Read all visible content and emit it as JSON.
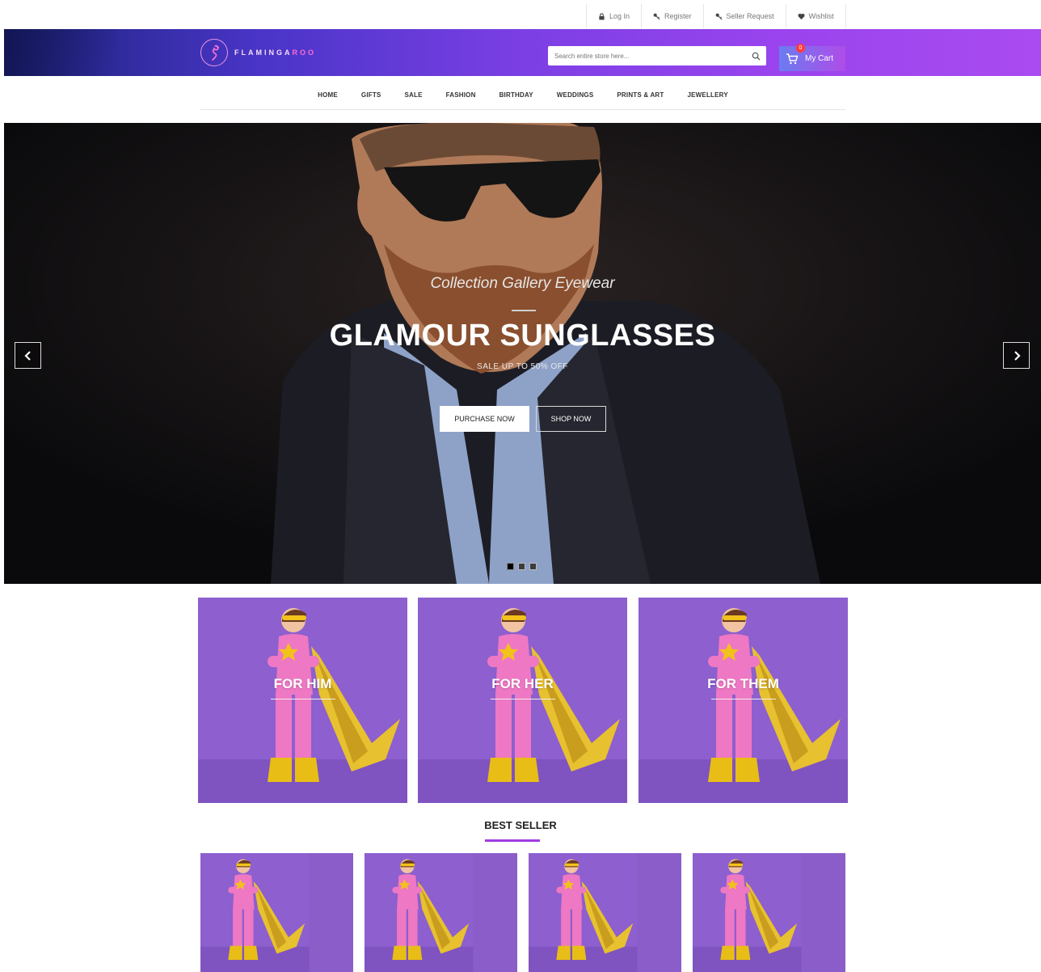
{
  "topbar": {
    "links": [
      {
        "label": "Log In",
        "icon": "lock-icon"
      },
      {
        "label": "Register",
        "icon": "key-icon"
      },
      {
        "label": "Seller Request",
        "icon": "key-icon"
      },
      {
        "label": "Wishlist",
        "icon": "heart-icon"
      }
    ]
  },
  "header": {
    "brand_a": "FLAMINGA",
    "brand_b": "ROO",
    "search_placeholder": "Search entire store here...",
    "cart_label": "My Cart",
    "cart_count": "0"
  },
  "nav": {
    "items": [
      "HOME",
      "GIFTS",
      "SALE",
      "FASHION",
      "BIRTHDAY",
      "WEDDINGS",
      "PRINTS & ART",
      "JEWELLERY"
    ]
  },
  "hero": {
    "subtitle": "Collection Gallery Eyewear",
    "title": "GLAMOUR SUNGLASSES",
    "sale_text": "SALE UP TO 50% OFF",
    "purchase_label": "PURCHASE NOW",
    "shop_label": "SHOP NOW",
    "slides": 3,
    "active_slide": 1
  },
  "categories": [
    {
      "label": "FOR HIM"
    },
    {
      "label": "FOR HER"
    },
    {
      "label": "FOR THEM"
    }
  ],
  "best_seller": {
    "title": "BEST SELLER",
    "product_count": 4
  },
  "colors": {
    "accent": "#a23be0",
    "tile_bg": "#8a5dc9",
    "badge": "#ff3b3b"
  }
}
